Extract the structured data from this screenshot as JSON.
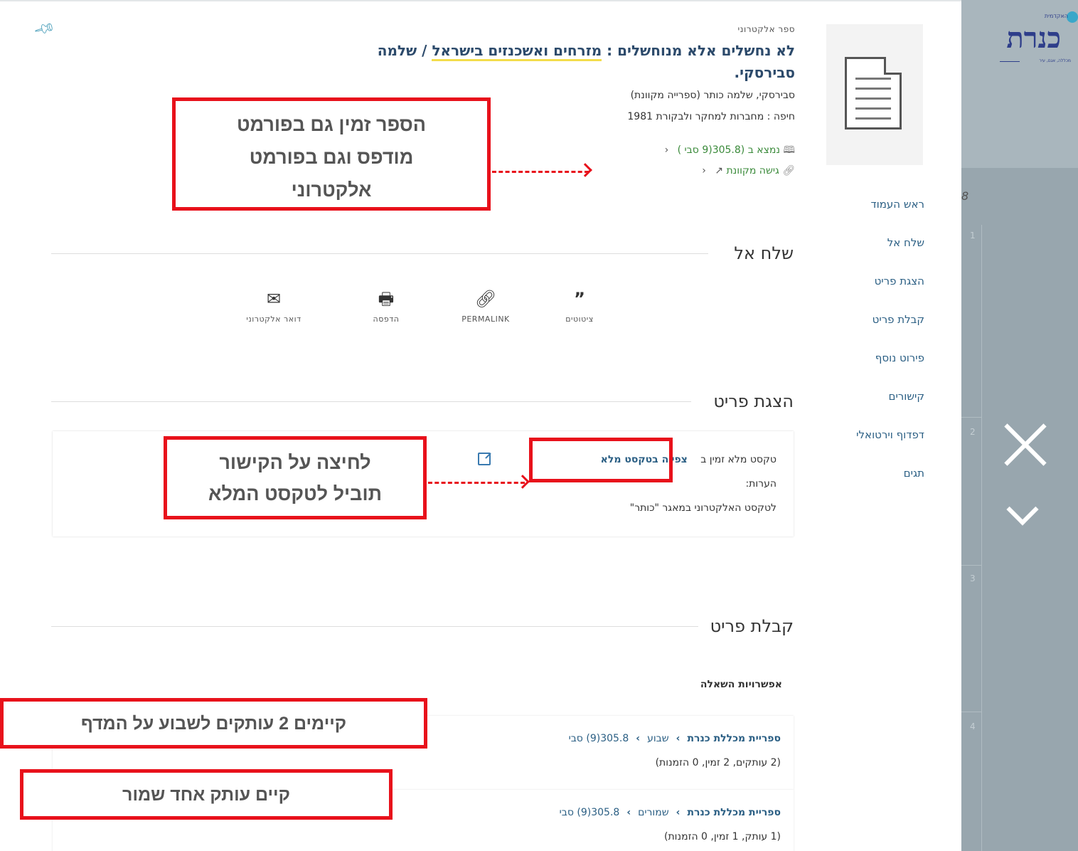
{
  "logo": {
    "text": "כנרת",
    "small": "האקדמית",
    "tagline": "מכללה, אגם, עיר"
  },
  "background": {
    "italic_number": "8",
    "row_numbers": [
      "1",
      "2",
      "3",
      "4"
    ]
  },
  "record": {
    "type": "ספר אלקטרוני",
    "title_part1": "לא נחשלים אלא מנוחשלים : ",
    "title_highlight": "מזרחים ואשכנזים בישראל",
    "title_part2": " / שלמה סבירסקי.",
    "author": "סבירסקי, שלמה כותר (ספרייה מקוונת)",
    "publisher": "חיפה : מחברות למחקר ולבקורת 1981",
    "location": "נמצא ב  (305.8(9 סבי )",
    "access": "גישה מקוונת"
  },
  "nav": {
    "items": [
      "ראש העמוד",
      "שלח אל",
      "הצגת פריט",
      "קבלת פריט",
      "פירוט נוסף",
      "קישורים",
      "דפדוף וירטואלי",
      "תגים"
    ]
  },
  "send_to": {
    "title": "שלח אל",
    "actions": [
      {
        "label": "ציטוטים",
        "icon": "quote-icon"
      },
      {
        "label": "PERMALINK",
        "icon": "link-icon"
      },
      {
        "label": "הדפסה",
        "icon": "print-icon"
      },
      {
        "label": "דואר אלקטרוני",
        "icon": "mail-icon"
      }
    ]
  },
  "display": {
    "title": "הצגת פריט",
    "fulltext_prefix": "טקסט מלא זמין ב",
    "fulltext_link": "צפייה בטקסט מלא",
    "notes_label": "הערות:",
    "notes_text": "לטקסט האלקטרוני במאגר \"כותר\""
  },
  "get_it": {
    "title": "קבלת פריט",
    "options_title": "אפשרויות השאלה",
    "holdings": [
      {
        "library": "ספריית מכללת כנרת",
        "location": "שבוע",
        "call": "305.8(9) סבי",
        "summary": "(2 עותקים, 2 זמין, 0 הזמנות)"
      },
      {
        "library": "ספריית מכללת כנרת",
        "location": "שמורים",
        "call": "305.8(9) סבי",
        "summary": "(1 עותק, 1 זמין, 0 הזמנות)"
      }
    ]
  },
  "annotations": {
    "format": [
      "הספר זמין גם בפורמט",
      "מודפס וגם בפורמט",
      "אלקטרוני"
    ],
    "link": [
      "לחיצה על הקישור",
      "תוביל לטקסט המלא"
    ],
    "copies": "קיימים 2 עותקים לשבוע על המדף",
    "reserve": "קיים עותק אחד שמור"
  },
  "colors": {
    "annotation_red": "#e8111b",
    "link_blue": "#2b5f84",
    "available_green": "#3a8a3a",
    "highlight_yellow": "#f3dd4c"
  }
}
